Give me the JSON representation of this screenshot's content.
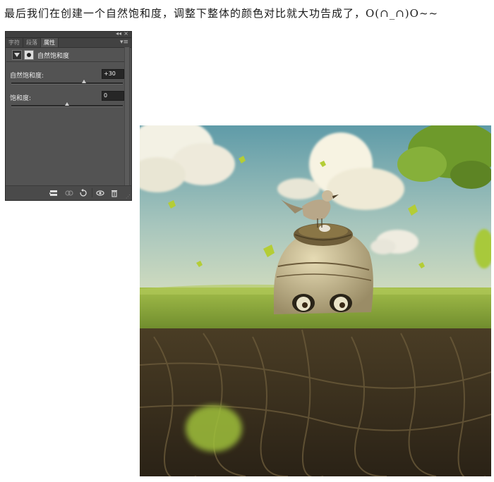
{
  "intro": {
    "text": "最后我们在创建一个自然饱和度，调整下整体的颜色对比就大功告成了，O(∩_∩)O~~"
  },
  "panel": {
    "collapse_glyph": "◂◂",
    "close_glyph": "×",
    "menu_glyph": "▾≡",
    "tabs": [
      {
        "label": "字符",
        "active": false
      },
      {
        "label": "段落",
        "active": false
      },
      {
        "label": "属性",
        "active": true
      }
    ],
    "layer": {
      "adjustment_icon": "vibrance-adjustment-icon",
      "mask_icon": "layer-mask-icon",
      "title": "自然饱和度"
    },
    "params": {
      "vibrance": {
        "label": "自然饱和度:",
        "value": "+30",
        "slider_fraction": 0.65
      },
      "saturation": {
        "label": "饱和度:",
        "value": "0",
        "slider_fraction": 0.5
      }
    },
    "bottom_icons": [
      "clip-to-layer-icon",
      "view-previous-state-icon",
      "reset-icon",
      "visibility-eye-icon",
      "delete-trash-icon"
    ],
    "colors": {
      "panel_bg": "#535353",
      "tab_bar_bg": "#424242",
      "input_bg": "#262626"
    }
  },
  "artwork": {
    "description_icon": "skull-nest-bird-artwork",
    "colors": {
      "sky_top": "#6ea6b2",
      "sky_bottom": "#c7d8c4",
      "grass": "#8fae3a",
      "soil": "#3b3020",
      "skull": "#c9bb92",
      "leaf": "#b9d135"
    }
  }
}
